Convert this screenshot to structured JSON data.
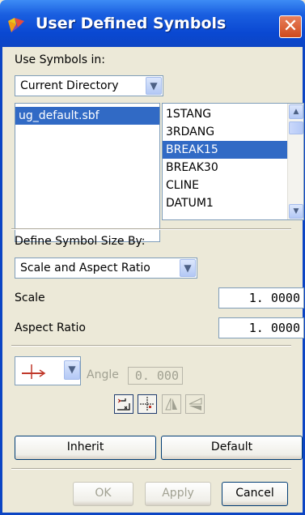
{
  "window": {
    "title": "User Defined Symbols",
    "close_glyph": "✕"
  },
  "use_symbols": {
    "label": "Use Symbols in:",
    "selected": "Current Directory"
  },
  "files": [
    {
      "name": "ug_default.sbf",
      "selected": true
    }
  ],
  "symbols": [
    {
      "name": "1STANG",
      "selected": false
    },
    {
      "name": "3RDANG",
      "selected": false
    },
    {
      "name": "BREAK15",
      "selected": true
    },
    {
      "name": "BREAK30",
      "selected": false
    },
    {
      "name": "CLINE",
      "selected": false
    },
    {
      "name": "DATUM1",
      "selected": false
    }
  ],
  "size": {
    "label": "Define Symbol Size By:",
    "selected": "Scale and Aspect Ratio",
    "scale_label": "Scale",
    "scale_value": "1. 0000",
    "aspect_label": "Aspect Ratio",
    "aspect_value": "1. 0000"
  },
  "angle": {
    "label": "Angle",
    "value": "0. 000"
  },
  "tools": [
    {
      "icon": "attach-leader-icon",
      "enabled": true
    },
    {
      "icon": "crosshair-origin-icon",
      "enabled": true
    },
    {
      "icon": "mirror-icon",
      "enabled": false
    },
    {
      "icon": "flip-icon",
      "enabled": false
    }
  ],
  "buttons": {
    "inherit": "Inherit",
    "default": "Default",
    "ok": "OK",
    "apply": "Apply",
    "cancel": "Cancel"
  },
  "colors": {
    "title_bar": "#0a48d2",
    "selection": "#316ac5",
    "dialog_bg": "#ece9d8"
  }
}
